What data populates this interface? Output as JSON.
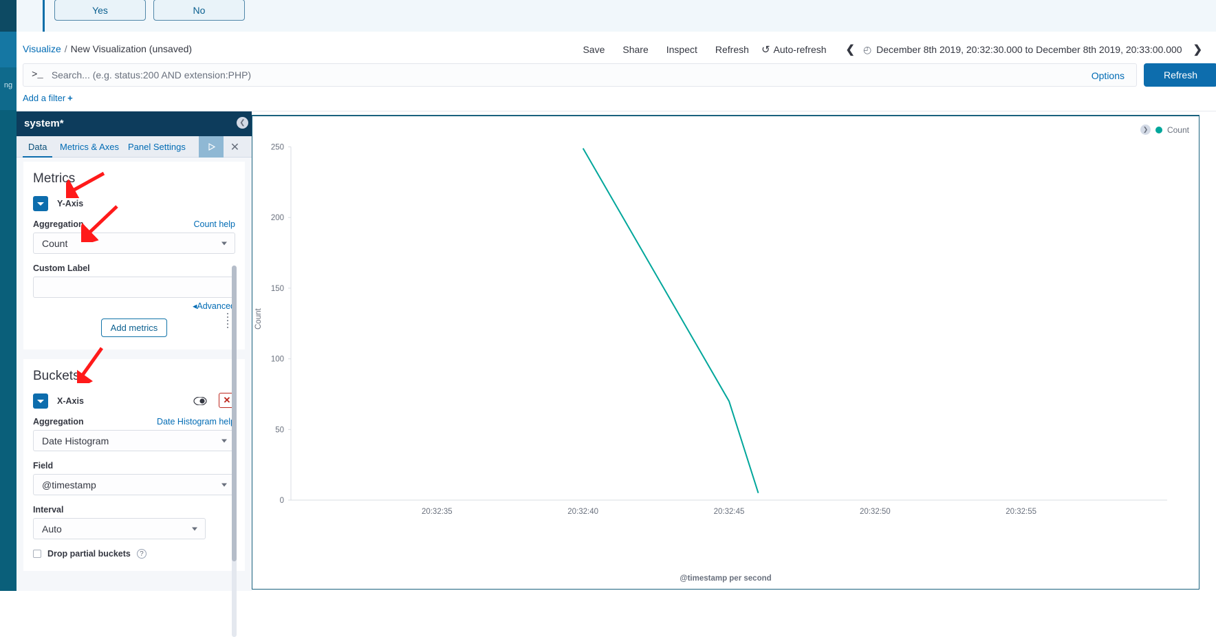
{
  "rail": {
    "label": "ng"
  },
  "notification": {
    "yes_label": "Yes",
    "no_label": "No"
  },
  "breadcrumb": {
    "root": "Visualize",
    "separator": "/",
    "current": "New Visualization (unsaved)"
  },
  "topbar": {
    "save": "Save",
    "share": "Share",
    "inspect": "Inspect",
    "refresh": "Refresh",
    "auto_refresh": "Auto-refresh",
    "auto_refresh_icon": "refresh-icon",
    "prev_icon": "chevron-left-icon",
    "next_icon": "chevron-right-icon",
    "clock_icon": "clock-icon",
    "date_range": "December 8th 2019, 20:32:30.000 to December 8th 2019, 20:33:00.000"
  },
  "search": {
    "prompt_icon": ">_",
    "placeholder": "Search... (e.g. status:200 AND extension:PHP)",
    "value": "",
    "options_label": "Options",
    "refresh_button": "Refresh"
  },
  "filters": {
    "add_filter_label": "Add a filter",
    "plus_icon": "+"
  },
  "editor": {
    "index_pattern": "system*",
    "tabs": [
      {
        "label": "Data",
        "active": true
      },
      {
        "label": "Metrics & Axes",
        "active": false
      },
      {
        "label": "Panel Settings",
        "active": false
      }
    ],
    "apply_icon": "play-icon",
    "close_icon": "close-icon",
    "metrics": {
      "section_title": "Metrics",
      "axis_label": "Y-Axis",
      "aggregation_label": "Aggregation",
      "aggregation_help": "Count help",
      "aggregation_value": "Count",
      "custom_label_label": "Custom Label",
      "custom_label_value": "",
      "advanced_label": "Advanced",
      "advanced_icon": "triangle-left-icon",
      "add_metrics_label": "Add metrics"
    },
    "buckets": {
      "section_title": "Buckets",
      "axis_label": "X-Axis",
      "toggle_icon": "eye-toggle-icon",
      "remove_icon": "close-x-icon",
      "aggregation_label": "Aggregation",
      "aggregation_help": "Date Histogram help",
      "aggregation_value": "Date Histogram",
      "field_label": "Field",
      "field_value": "@timestamp",
      "interval_label": "Interval",
      "interval_value": "Auto",
      "drop_partial_label": "Drop partial buckets",
      "help_icon": "question-mark-icon"
    }
  },
  "chart_data": {
    "type": "line",
    "title": "",
    "xlabel": "@timestamp per second",
    "ylabel": "Count",
    "legend": [
      {
        "name": "Count",
        "color": "#00a69b"
      }
    ],
    "legend_position": "top-right",
    "grid": false,
    "ylim": [
      0,
      260
    ],
    "yticks": [
      0,
      50,
      100,
      150,
      200,
      250
    ],
    "xticks": [
      "20:32:35",
      "20:32:40",
      "20:32:45",
      "20:32:50",
      "20:32:55"
    ],
    "series": [
      {
        "name": "Count",
        "color": "#00a69b",
        "x": [
          "20:32:40",
          "20:32:45",
          "20:32:46"
        ],
        "values": [
          249,
          70,
          5
        ]
      }
    ]
  },
  "annotations": {
    "arrow_color": "#ff1a1a",
    "arrows": [
      "points-to-y-axis",
      "points-to-count-aggregation",
      "points-to-x-axis"
    ]
  },
  "colors": {
    "accent": "#006bb4",
    "primary_button": "#0d6dad",
    "series": "#00a69b",
    "danger": "#bd271e",
    "header_dark": "#0d3c5c"
  }
}
